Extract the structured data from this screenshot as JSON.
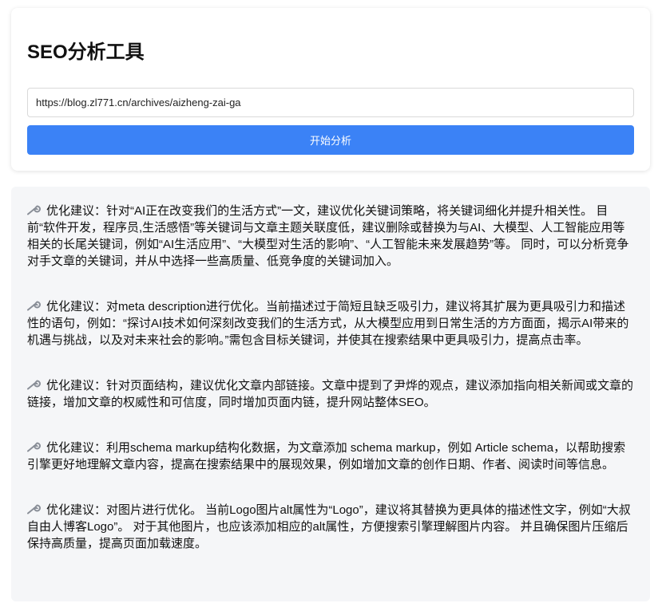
{
  "header": {
    "title": "SEO分析工具"
  },
  "url_input": {
    "value": "https://blog.zl771.cn/archives/aizheng-zai-ga",
    "placeholder": ""
  },
  "analyze_button": {
    "label": "开始分析",
    "color": "#3b82f6"
  },
  "suggestions": [
    {
      "icon": "wrench-icon",
      "text": "优化建议：针对“AI正在改变我们的生活方式”一文，建议优化关键词策略，将关键词细化并提升相关性。 目前“软件开发，程序员,生活感悟”等关键词与文章主题关联度低，建议删除或替换为与AI、大模型、人工智能应用等相关的长尾关键词，例如“AI生活应用”、“大模型对生活的影响”、“人工智能未来发展趋势”等。 同时，可以分析竞争对手文章的关键词，并从中选择一些高质量、低竞争度的关键词加入。"
    },
    {
      "icon": "wrench-icon",
      "text": "优化建议：对meta description进行优化。当前描述过于简短且缺乏吸引力，建议将其扩展为更具吸引力和描述性的语句，例如：“探讨AI技术如何深刻改变我们的生活方式，从大模型应用到日常生活的方方面面，揭示AI带来的机遇与挑战，以及对未来社会的影响。”需包含目标关键词，并使其在搜索结果中更具吸引力，提高点击率。"
    },
    {
      "icon": "wrench-icon",
      "text": "优化建议：针对页面结构，建议优化文章内部链接。文章中提到了尹烨的观点，建议添加指向相关新闻或文章的链接，增加文章的权威性和可信度，同时增加页面内链，提升网站整体SEO。"
    },
    {
      "icon": "wrench-icon",
      "text": "优化建议：利用schema markup结构化数据，为文章添加 schema markup，例如 Article schema，以帮助搜索引擎更好地理解文章内容，提高在搜索结果中的展现效果，例如增加文章的创作日期、作者、阅读时间等信息。"
    },
    {
      "icon": "wrench-icon",
      "text": "优化建议：对图片进行优化。 当前Logo图片alt属性为“Logo”，建议将其替换为更具体的描述性文字，例如“大叔自由人博客Logo”。 对于其他图片，也应该添加相应的alt属性，方便搜索引擎理解图片内容。 并且确保图片压缩后保持高质量，提高页面加载速度。"
    }
  ]
}
